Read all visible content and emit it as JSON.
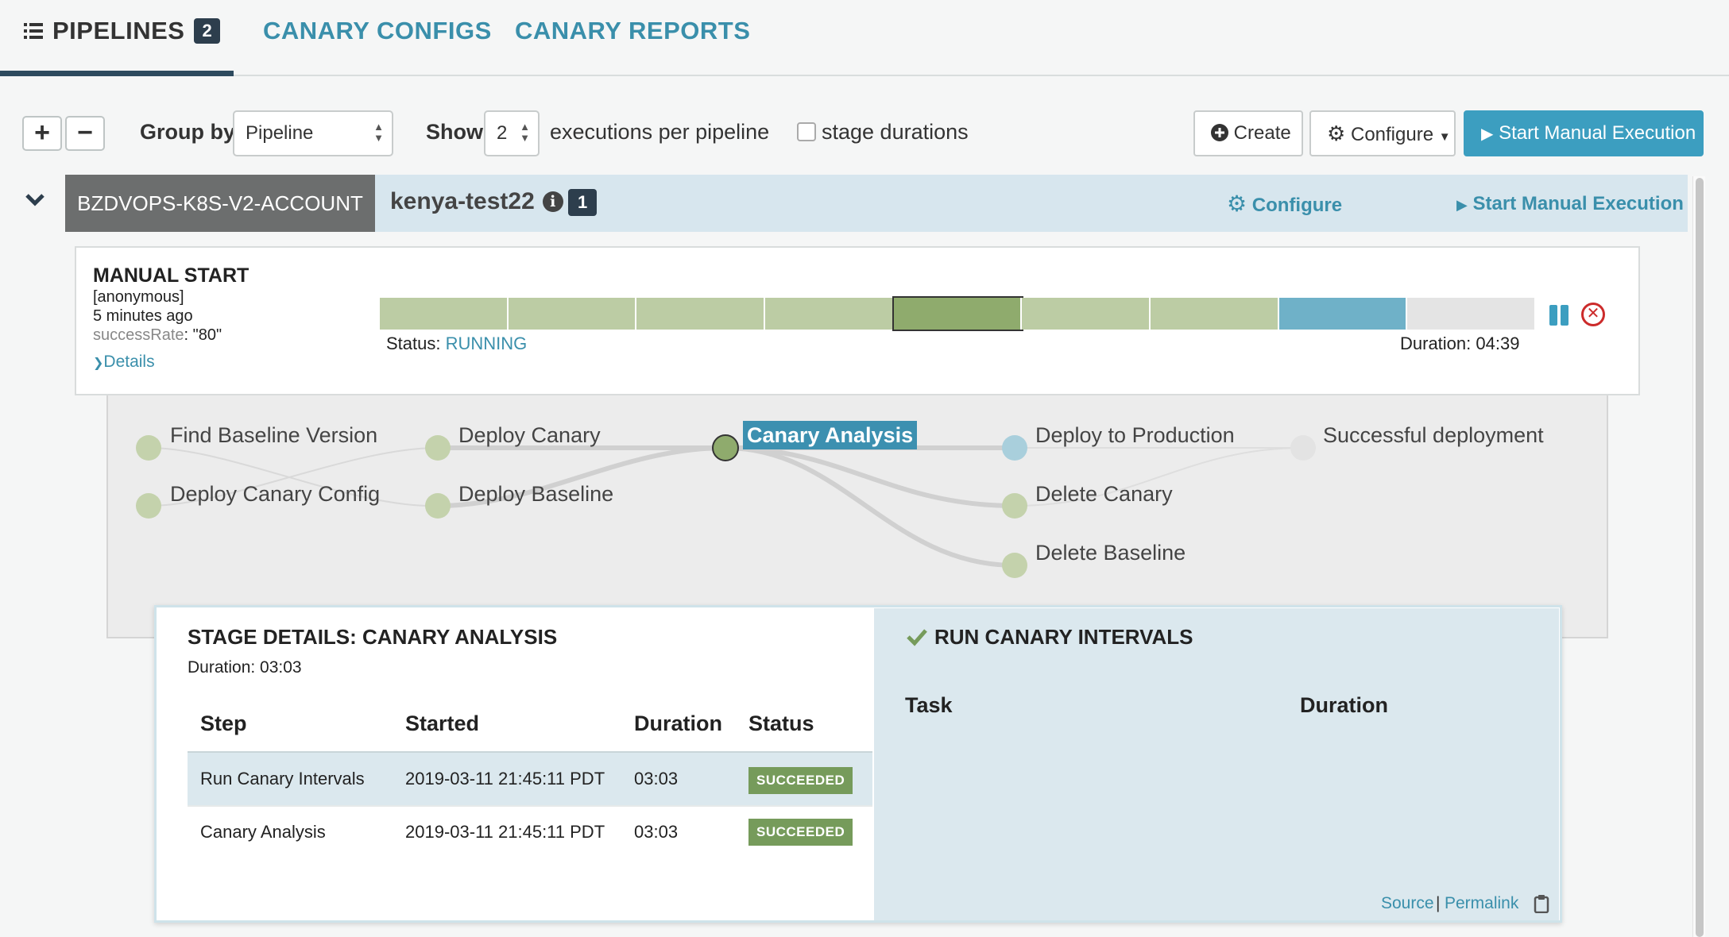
{
  "nav": {
    "pipelines_label": "PIPELINES",
    "pipelines_count": "2",
    "canary_configs_label": "CANARY CONFIGS",
    "canary_reports_label": "CANARY REPORTS"
  },
  "toolbar": {
    "expand_label": "+",
    "collapse_label": "−",
    "group_by_label": "Group by",
    "group_by_value": "Pipeline",
    "show_label": "Show",
    "show_value": "2",
    "executions_label": "executions per pipeline",
    "stage_durations_label": "stage durations",
    "stage_durations_checked": false,
    "create_label": "Create",
    "configure_label": "Configure",
    "start_label": "Start Manual Execution"
  },
  "pipeline": {
    "account": "BZDVOPS-K8S-V2-ACCOUNT",
    "name": "kenya-test22",
    "count": "1",
    "configure_label": "Configure",
    "start_label": "Start Manual Execution"
  },
  "execution": {
    "trigger": "MANUAL START",
    "user": "[anonymous]",
    "time": "5 minutes ago",
    "param_key": "successRate",
    "param_value": ": \"80\"",
    "details_label": "Details",
    "status_label": "Status:",
    "status_value": "RUNNING",
    "duration": "Duration: 04:39",
    "segments": [
      {
        "name": "Find Baseline Version",
        "color": "#bccca4",
        "state": "succeeded"
      },
      {
        "name": "Deploy Canary Config",
        "color": "#bccca4",
        "state": "succeeded"
      },
      {
        "name": "Deploy Canary",
        "color": "#bccca4",
        "state": "succeeded"
      },
      {
        "name": "Deploy Baseline",
        "color": "#bccca4",
        "state": "succeeded"
      },
      {
        "name": "Canary Analysis",
        "color": "#8fab6d",
        "state": "selected"
      },
      {
        "name": "Deploy to Production",
        "color": "#bccca4",
        "state": "succeeded"
      },
      {
        "name": "Delete Canary",
        "color": "#bccca4",
        "state": "succeeded"
      },
      {
        "name": "Delete Baseline",
        "color": "#6fb1c8",
        "state": "running"
      },
      {
        "name": "Successful deployment",
        "color": "#e4e4e4",
        "state": "not-started"
      }
    ]
  },
  "graph": {
    "nodes": {
      "find_baseline": "Find Baseline Version",
      "deploy_canary_config": "Deploy Canary Config",
      "deploy_canary": "Deploy Canary",
      "deploy_baseline": "Deploy Baseline",
      "canary_analysis": "Canary Analysis",
      "deploy_production": "Deploy to Production",
      "delete_canary": "Delete Canary",
      "delete_baseline": "Delete Baseline",
      "successful_deployment": "Successful deployment"
    }
  },
  "stage_details": {
    "title": "STAGE DETAILS: CANARY ANALYSIS",
    "duration": "Duration: 03:03",
    "columns": [
      "Step",
      "Started",
      "Duration",
      "Status"
    ],
    "rows": [
      {
        "step": "Run Canary Intervals",
        "started": "2019-03-11 21:45:11 PDT",
        "duration": "03:03",
        "status": "SUCCEEDED"
      },
      {
        "step": "Canary Analysis",
        "started": "2019-03-11 21:45:11 PDT",
        "duration": "03:03",
        "status": "SUCCEEDED"
      }
    ],
    "run_title": "RUN CANARY INTERVALS",
    "run_columns": [
      "Task",
      "Duration"
    ],
    "source_label": "Source",
    "separator": "|",
    "permalink_label": "Permalink"
  },
  "colors": {
    "accent": "#3a8fab",
    "primary_button": "#3c9ec0",
    "succeeded": "#769b5b",
    "badge_dark": "#2d3e4d",
    "danger": "#cc2b2b"
  },
  "icons": {
    "pipelines": "list-icon",
    "create": "plus-circle-icon",
    "configure": "gear-icon",
    "start": "play-icon",
    "info": "info-circle-icon",
    "expand": "chevron-down-icon",
    "pause": "pause-icon",
    "cancel": "times-circle-icon",
    "check": "check-icon",
    "clipboard": "clipboard-icon"
  }
}
